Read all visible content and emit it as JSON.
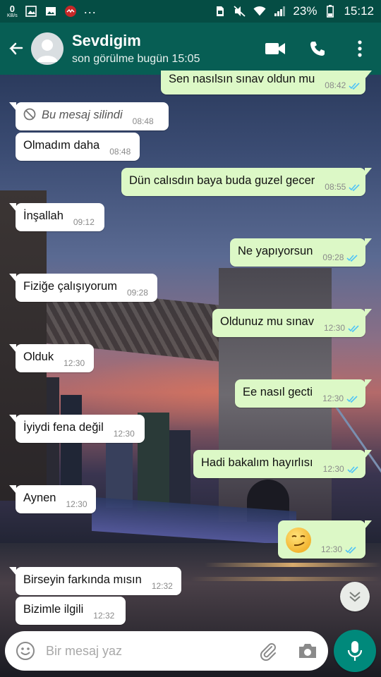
{
  "status_bar": {
    "speed_value": "0",
    "speed_unit": "KB/s",
    "more_indicator": "...",
    "battery_percent": "23%",
    "time": "15:12",
    "icons": [
      "gallery-icon",
      "image-icon",
      "app-notification-icon",
      "sim-icon",
      "mute-icon",
      "wifi-icon",
      "signal-icon",
      "battery-icon"
    ]
  },
  "header": {
    "contact_name": "Sevdigim",
    "last_seen": "son görülme bugün 15:05",
    "icons": [
      "back-arrow-icon",
      "avatar-icon",
      "video-call-icon",
      "phone-icon",
      "more-vert-icon"
    ]
  },
  "colors": {
    "header_bg": "#075e54",
    "status_bg": "#054d44",
    "outgoing_bubble": "#dcf8c6",
    "incoming_bubble": "#ffffff",
    "read_ticks": "#4fc3f7",
    "fab": "#00897b"
  },
  "messages": [
    {
      "direction": "out",
      "text": "Sen nasılsın sınav oldun mu",
      "time": "08:42",
      "status": "read"
    },
    {
      "direction": "in",
      "text": "Bu mesaj silindi",
      "time": "08:48",
      "deleted": true
    },
    {
      "direction": "in",
      "text": "Olmadım daha",
      "time": "08:48"
    },
    {
      "direction": "out",
      "text": "Dün calısdın baya buda guzel gecer",
      "time": "08:55",
      "status": "read"
    },
    {
      "direction": "in",
      "text": "İnşallah",
      "time": "09:12"
    },
    {
      "direction": "out",
      "text": "Ne yapıyorsun",
      "time": "09:28",
      "status": "read"
    },
    {
      "direction": "in",
      "text": "Fiziğe çalışıyorum",
      "time": "09:28"
    },
    {
      "direction": "out",
      "text": "Oldunuz mu sınav",
      "time": "12:30",
      "status": "read"
    },
    {
      "direction": "in",
      "text": "Olduk",
      "time": "12:30"
    },
    {
      "direction": "out",
      "text": "Ee nasıl gecti",
      "time": "12:30",
      "status": "read"
    },
    {
      "direction": "in",
      "text": "İyiydi fena değil",
      "time": "12:30"
    },
    {
      "direction": "out",
      "text": "Hadi bakalım hayırlısı",
      "time": "12:30",
      "status": "read"
    },
    {
      "direction": "in",
      "text": "Aynen",
      "time": "12:30"
    },
    {
      "direction": "out",
      "emoji": "smirking-face-emoji",
      "time": "12:30",
      "status": "read"
    },
    {
      "direction": "in",
      "text": "Birseyin farkında mısın",
      "time": "12:32"
    },
    {
      "direction": "in",
      "text": "Bizimle ilgili",
      "time": "12:32"
    }
  ],
  "composer": {
    "placeholder": "Bir mesaj yaz",
    "icons": [
      "emoji-icon",
      "attach-icon",
      "camera-icon",
      "mic-icon"
    ]
  },
  "scroll_button_icon": "double-chevron-down-icon"
}
